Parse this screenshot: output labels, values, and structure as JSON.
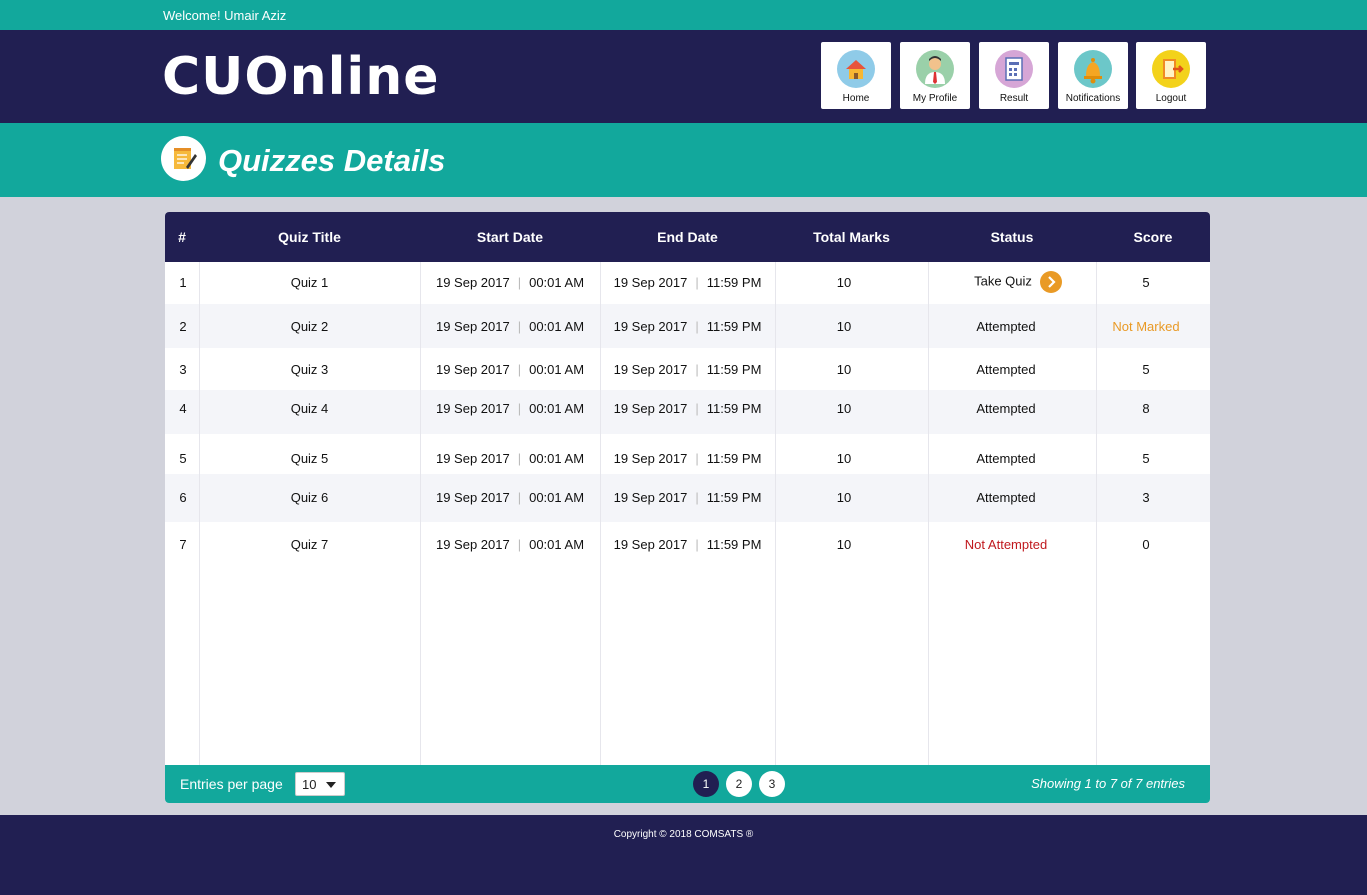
{
  "topbar": {
    "welcome": "Welcome! Umair Aziz"
  },
  "header": {
    "logo": "CUOnline",
    "nav": [
      {
        "label": "Home",
        "icon": "home-icon",
        "color": "#8fcbe8"
      },
      {
        "label": "My Profile",
        "icon": "profile-icon",
        "color": "#9ad0a9"
      },
      {
        "label": "Result",
        "icon": "result-icon",
        "color": "#d6a6d6"
      },
      {
        "label": "Notifications",
        "icon": "bell-icon",
        "color": "#6cc7c9"
      },
      {
        "label": "Logout",
        "icon": "logout-icon",
        "color": "#f3d21b"
      }
    ]
  },
  "page_title": "Quizzes Details",
  "table": {
    "headers": [
      "#",
      "Quiz Title",
      "Start Date",
      "End Date",
      "Total Marks",
      "Status",
      "Score"
    ],
    "rows": [
      {
        "num": "1",
        "title": "Quiz 1",
        "start_date": "19 Sep 2017",
        "start_time": "00:01 AM",
        "end_date": "19 Sep 2017",
        "end_time": "11:59 PM",
        "total": "10",
        "status": "Take Quiz",
        "score": "5"
      },
      {
        "num": "2",
        "title": "Quiz 2",
        "start_date": "19 Sep 2017",
        "start_time": "00:01 AM",
        "end_date": "19 Sep 2017",
        "end_time": "11:59 PM",
        "total": "10",
        "status": "Attempted",
        "score": "Not Marked"
      },
      {
        "num": "3",
        "title": "Quiz 3",
        "start_date": "19 Sep 2017",
        "start_time": "00:01 AM",
        "end_date": "19 Sep 2017",
        "end_time": "11:59 PM",
        "total": "10",
        "status": "Attempted",
        "score": "5"
      },
      {
        "num": "4",
        "title": "Quiz 4",
        "start_date": "19 Sep 2017",
        "start_time": "00:01 AM",
        "end_date": "19 Sep 2017",
        "end_time": "11:59 PM",
        "total": "10",
        "status": "Attempted",
        "score": "8"
      },
      {
        "num": "5",
        "title": "Quiz 5",
        "start_date": "19 Sep 2017",
        "start_time": "00:01 AM",
        "end_date": "19 Sep 2017",
        "end_time": "11:59 PM",
        "total": "10",
        "status": "Attempted",
        "score": "5"
      },
      {
        "num": "6",
        "title": "Quiz 6",
        "start_date": "19 Sep 2017",
        "start_time": "00:01 AM",
        "end_date": "19 Sep 2017",
        "end_time": "11:59 PM",
        "total": "10",
        "status": "Attempted",
        "score": "3"
      },
      {
        "num": "7",
        "title": "Quiz 7",
        "start_date": "19 Sep 2017",
        "start_time": "00:01 AM",
        "end_date": "19 Sep 2017",
        "end_time": "11:59 PM",
        "total": "10",
        "status": "Not Attempted",
        "score": "0"
      }
    ]
  },
  "table_footer": {
    "entries_label": "Entries per page",
    "entries_value": "10",
    "pages": [
      "1",
      "2",
      "3"
    ],
    "active_page": "1",
    "showing": "Showing 1 to 7 of  7 entries"
  },
  "colors": {
    "teal": "#12a89c",
    "navy": "#211f52",
    "orange": "#e99a26",
    "red": "#c0191e"
  },
  "footer": {
    "copyright": "Copyright © 2018 COMSATS ®"
  }
}
